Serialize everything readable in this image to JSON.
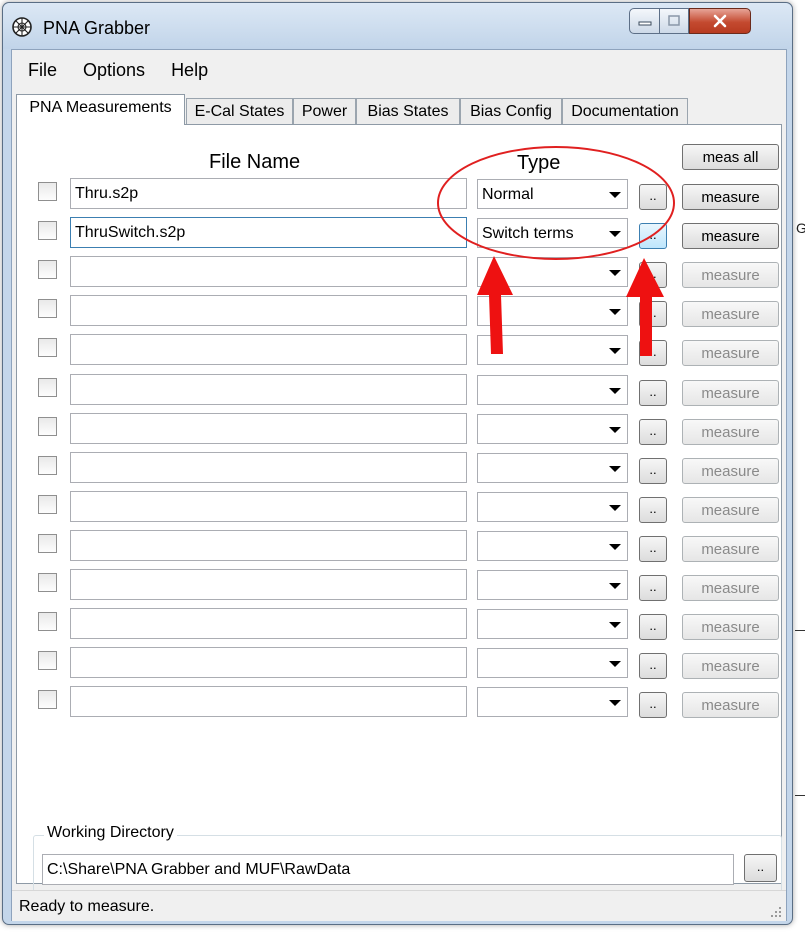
{
  "window": {
    "title": "PNA Grabber",
    "minimize_icon": "minimize-icon",
    "maximize_icon": "maximize-icon",
    "close_icon": "close-icon"
  },
  "menu": [
    "File",
    "Options",
    "Help"
  ],
  "tabs": [
    "PNA Measurements",
    "E-Cal States",
    "Power",
    "Bias States",
    "Bias Config",
    "Documentation"
  ],
  "active_tab": "PNA Measurements",
  "headers": {
    "file_name": "File Name",
    "type": "Type"
  },
  "meas_all_label": "meas all",
  "browse_label": "..",
  "measure_label": "measure",
  "rows": [
    {
      "file": "Thru.s2p",
      "type": "Normal",
      "enabled": true
    },
    {
      "file": "ThruSwitch.s2p",
      "type": "Switch terms",
      "enabled": true
    },
    {
      "file": "",
      "type": "",
      "enabled": false
    },
    {
      "file": "",
      "type": "",
      "enabled": false
    },
    {
      "file": "",
      "type": "",
      "enabled": false
    },
    {
      "file": "",
      "type": "",
      "enabled": false
    },
    {
      "file": "",
      "type": "",
      "enabled": false
    },
    {
      "file": "",
      "type": "",
      "enabled": false
    },
    {
      "file": "",
      "type": "",
      "enabled": false
    },
    {
      "file": "",
      "type": "",
      "enabled": false
    },
    {
      "file": "",
      "type": "",
      "enabled": false
    },
    {
      "file": "",
      "type": "",
      "enabled": false
    },
    {
      "file": "",
      "type": "",
      "enabled": false
    },
    {
      "file": "",
      "type": "",
      "enabled": false
    }
  ],
  "working_directory": {
    "label": "Working Directory",
    "value": "C:\\Share\\PNA Grabber and MUF\\RawData",
    "browse_label": ".."
  },
  "status": "Ready to measure.",
  "annotation_colors": {
    "circle": "#e02020",
    "arrows": "#ee1111"
  }
}
